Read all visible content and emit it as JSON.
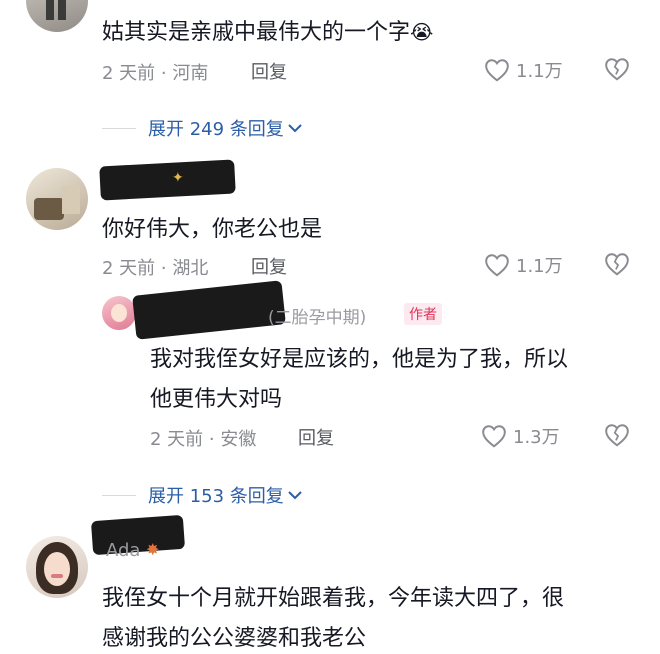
{
  "comments": [
    {
      "text": "姑其实是亲戚中最伟大的一个字",
      "emoji": "😭",
      "meta": "2 天前 · 河南",
      "reply_label": "回复",
      "likes": "1.1万"
    },
    {
      "text": "你好伟大，你老公也是",
      "meta": "2 天前 · 湖北",
      "reply_label": "回复",
      "likes": "1.1万"
    },
    {
      "name_suffix": "(二胎孕中期)",
      "author_badge": "作者",
      "text_line1": "我对我侄女好是应该的，他是为了我，所以",
      "text_line2": "他更伟大对吗",
      "meta": "2 天前 · 安徽",
      "reply_label": "回复",
      "likes": "1.3万"
    },
    {
      "name_fragment": "Ada",
      "text_line1": "我侄女十个月就开始跟着我，今年读大四了，很",
      "text_line2": "感谢我的公公婆婆和我老公"
    }
  ],
  "expand": [
    {
      "label": "展开 249 条回复"
    },
    {
      "label": "展开 153 条回复"
    }
  ],
  "icons": {
    "like": "heart-icon",
    "dislike": "broken-heart-icon",
    "chevron": "chevron-down-icon"
  },
  "colors": {
    "accent_link": "#2b5ea6",
    "author_badge": "#e0325a"
  }
}
